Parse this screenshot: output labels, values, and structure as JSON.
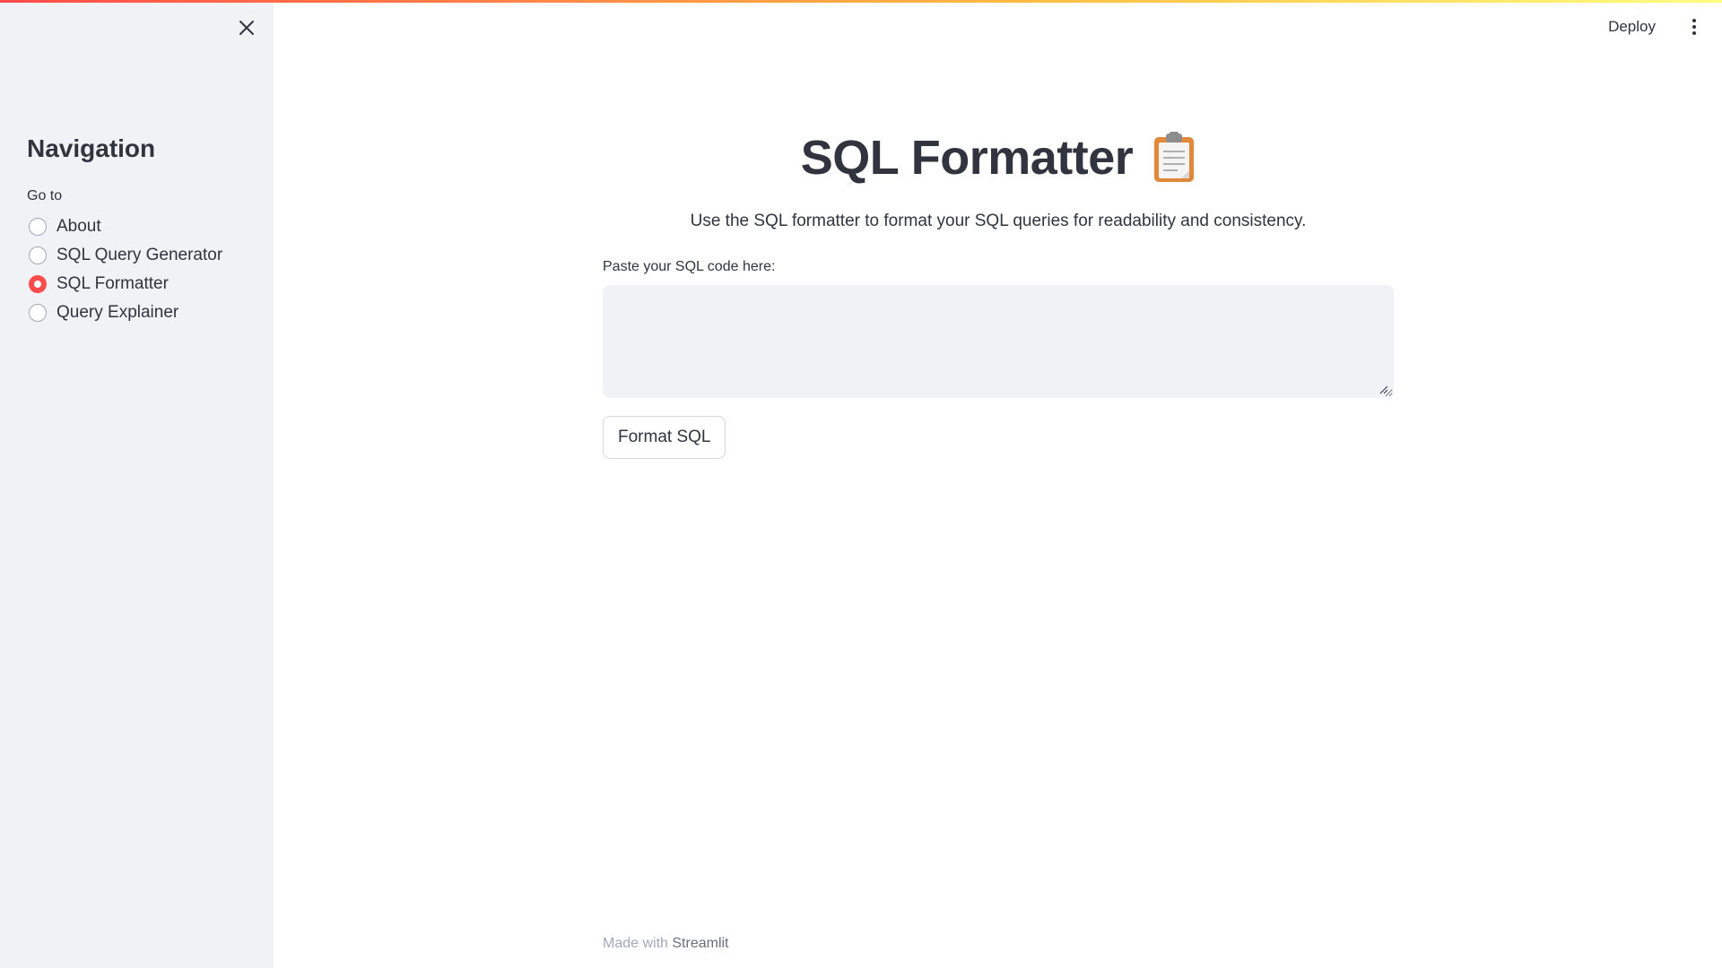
{
  "header": {
    "deploy_label": "Deploy",
    "menu_icon": "kebab-menu-icon",
    "accent_gradient": [
      "#ff4b4b",
      "#ffbd45",
      "#fffd80"
    ]
  },
  "sidebar": {
    "close_icon": "close-icon",
    "title": "Navigation",
    "radio_label": "Go to",
    "options": [
      {
        "label": "About",
        "selected": false
      },
      {
        "label": "SQL Query Generator",
        "selected": false
      },
      {
        "label": "SQL Formatter",
        "selected": true
      },
      {
        "label": "Query Explainer",
        "selected": false
      }
    ],
    "selected_color": "#ff4b4b"
  },
  "main": {
    "title": "SQL Formatter",
    "title_icon": "clipboard-icon",
    "subtitle": "Use the SQL formatter to format your SQL queries for readability and consistency.",
    "input_label": "Paste your SQL code here:",
    "input_value": "",
    "button_label": "Format SQL"
  },
  "footer": {
    "prefix": "Made with",
    "link": "Streamlit"
  }
}
